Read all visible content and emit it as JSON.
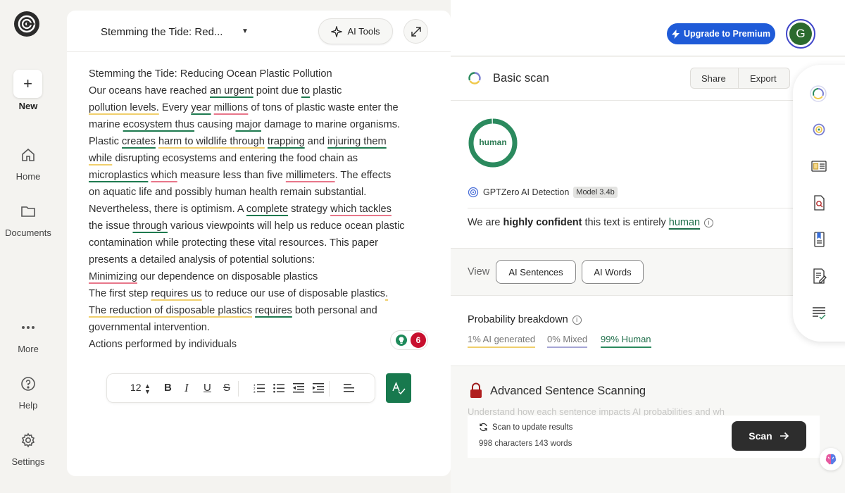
{
  "rail": {
    "new_label": "New",
    "home_label": "Home",
    "documents_label": "Documents",
    "more_label": "More",
    "help_label": "Help",
    "settings_label": "Settings"
  },
  "editor": {
    "doc_title": "Stemming the Tide: Red...",
    "ai_tools_label": "AI Tools",
    "flag_count": "6",
    "font_size": "12",
    "toolbar": {
      "bold": "B",
      "italic": "I",
      "underline": "U",
      "strike": "S"
    }
  },
  "doc_lines": [
    [
      {
        "t": "Stemming the Tide: Reducing Ocean Plastic Pollution"
      }
    ],
    [
      {
        "t": "Our oceans have reached "
      },
      {
        "t": "an urgent",
        "u": "g"
      },
      {
        "t": " point due "
      },
      {
        "t": "to",
        "u": "g"
      },
      {
        "t": " plastic"
      }
    ],
    [
      {
        "t": "pollution levels.",
        "u": "y"
      },
      {
        "t": " Every "
      },
      {
        "t": "year",
        "u": "g"
      },
      {
        "t": " "
      },
      {
        "t": "millions",
        "u": "r"
      },
      {
        "t": " of tons of plastic waste enter the"
      }
    ],
    [
      {
        "t": "marine "
      },
      {
        "t": "ecosystem thus",
        "u": "g"
      },
      {
        "t": " causing "
      },
      {
        "t": "major",
        "u": "g"
      },
      {
        "t": " damage to marine organisms."
      }
    ],
    [
      {
        "t": "Plastic "
      },
      {
        "t": "creates",
        "u": "g"
      },
      {
        "t": " "
      },
      {
        "t": "harm to wildlife through",
        "u": "y"
      },
      {
        "t": " "
      },
      {
        "t": "trapping",
        "u": "g"
      },
      {
        "t": " and "
      },
      {
        "t": "injuring them",
        "u": "g"
      }
    ],
    [
      {
        "t": "while",
        "u": "y"
      },
      {
        "t": " disrupting ecosystems and entering the food chain as"
      }
    ],
    [
      {
        "t": "microplastics",
        "u": "g"
      },
      {
        "t": " "
      },
      {
        "t": "which",
        "u": "r"
      },
      {
        "t": " measure less than five "
      },
      {
        "t": "millimeters",
        "u": "r"
      },
      {
        "t": ". The effects"
      }
    ],
    [
      {
        "t": "on aquatic life and possibly human health remain substantial."
      }
    ],
    [
      {
        "t": "Nevertheless, there is optimism. A "
      },
      {
        "t": "complete",
        "u": "g"
      },
      {
        "t": " strategy "
      },
      {
        "t": "which tackles",
        "u": "r"
      }
    ],
    [
      {
        "t": "the issue "
      },
      {
        "t": "through",
        "u": "g"
      },
      {
        "t": " various viewpoints will help us reduce ocean plastic"
      }
    ],
    [
      {
        "t": "contamination while protecting these vital resources. This paper"
      }
    ],
    [
      {
        "t": "presents a detailed analysis of potential solutions:"
      }
    ],
    [
      {
        "t": "Minimizing",
        "u": "r"
      },
      {
        "t": " our dependence on disposable plastics"
      }
    ],
    [
      {
        "t": "The first step "
      },
      {
        "t": "requires us",
        "u": "y"
      },
      {
        "t": " to reduce our use of disposable plastics"
      },
      {
        "t": ".",
        "u": "y"
      }
    ],
    [
      {
        "t": "The reduction of disposable plastics",
        "u": "y"
      },
      {
        "t": " "
      },
      {
        "t": "requires",
        "u": "g"
      },
      {
        "t": " both personal and"
      }
    ],
    [
      {
        "t": "governmental intervention."
      }
    ],
    [
      {
        "t": "Actions performed by individuals"
      }
    ]
  ],
  "header": {
    "upgrade_label": "Upgrade to Premium",
    "avatar_initial": "G"
  },
  "scan": {
    "title": "Basic scan",
    "share_label": "Share",
    "export_label": "Export",
    "donut_label": "human",
    "human_fraction": 0.99,
    "detector_label": "GPTZero AI Detection",
    "model_tag": "Model 3.4b",
    "confidence_prefix": "We are ",
    "confidence_bold": "highly confident",
    "confidence_mid": " this text is entirely ",
    "confidence_result": "human",
    "view_label": "View",
    "ai_sentences_label": "AI Sentences",
    "ai_words_label": "AI Words",
    "prob_title": "Probability breakdown",
    "prob_ai": "1% AI generated",
    "prob_mixed": "0% Mixed",
    "prob_human": "99% Human",
    "adv_title": "Advanced Sentence Scanning",
    "adv_desc": "Understand how each sentence impacts AI probabilities and wh",
    "scan_update_label": "Scan to update results",
    "char_word_count": "998 characters 143 words",
    "scan_button_label": "Scan"
  },
  "colors": {
    "human_green": "#2b8a5e",
    "ai_yellow": "#f0cf6c",
    "mixed_purple": "#8c8cc8",
    "upgrade_blue": "#1f5bd8",
    "flag_red": "#c8102e"
  }
}
